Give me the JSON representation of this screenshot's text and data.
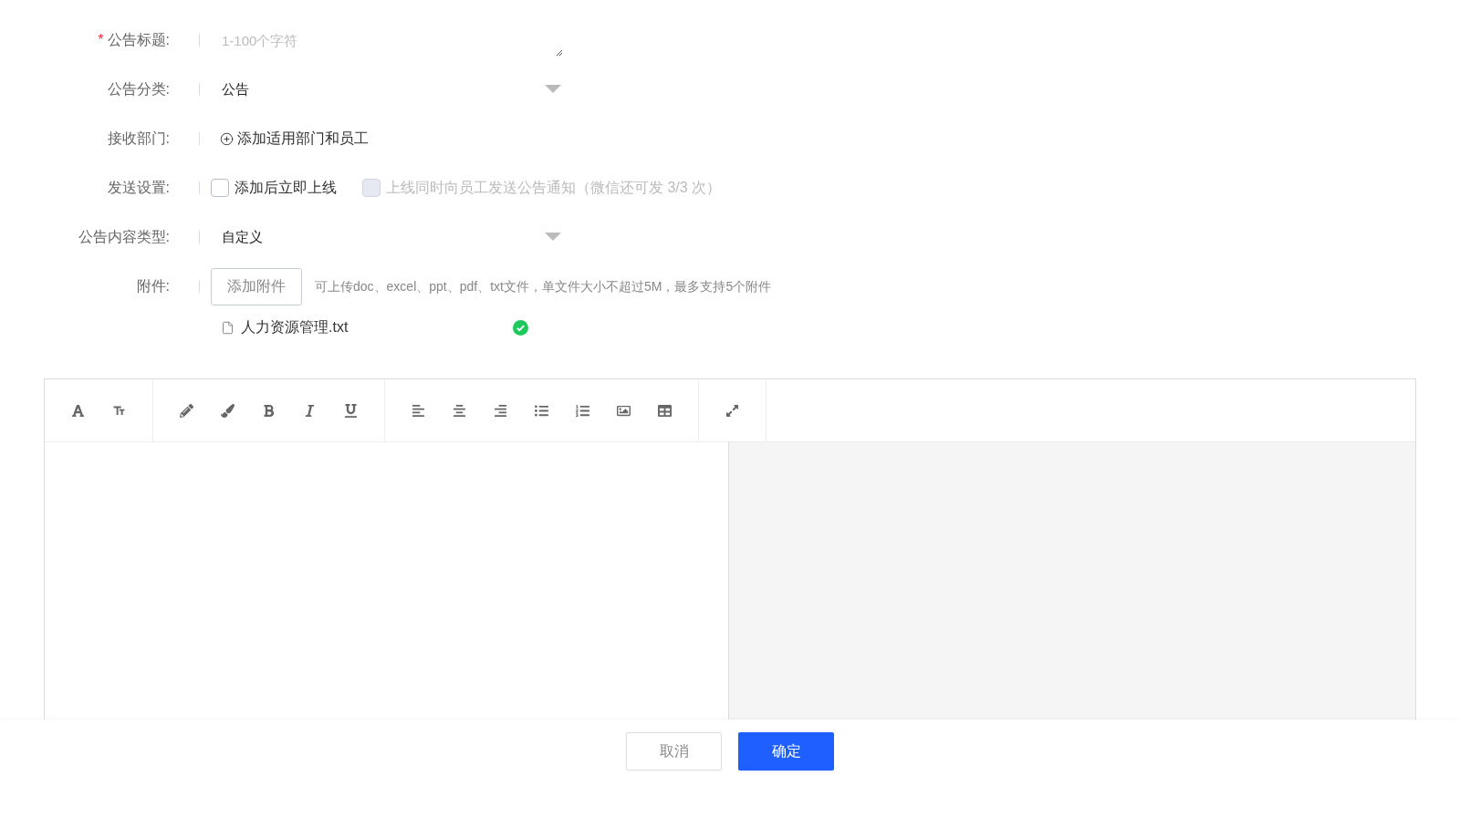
{
  "form": {
    "title": {
      "label": "公告标题:",
      "required": true,
      "required_mark": "*",
      "placeholder": "1-100个字符"
    },
    "category": {
      "label": "公告分类:",
      "value": "公告"
    },
    "recipients": {
      "label": "接收部门:",
      "action": "添加适用部门和员工"
    },
    "send": {
      "label": "发送设置:",
      "options": [
        {
          "label": "添加后立即上线",
          "checked": false,
          "disabled": false
        },
        {
          "label": "上线同时向员工发送公告通知（微信还可发 3/3 次）",
          "checked": false,
          "disabled": true
        }
      ]
    },
    "content_type": {
      "label": "公告内容类型:",
      "value": "自定义"
    },
    "attachment": {
      "label": "附件:",
      "button": "添加附件",
      "hint": "可上传doc、excel、ppt、pdf、txt文件，单文件大小不超过5M，最多支持5个附件",
      "files": [
        {
          "name": "人力资源管理.txt",
          "uploaded": true
        }
      ]
    }
  },
  "footer": {
    "cancel": "取消",
    "confirm": "确定"
  }
}
